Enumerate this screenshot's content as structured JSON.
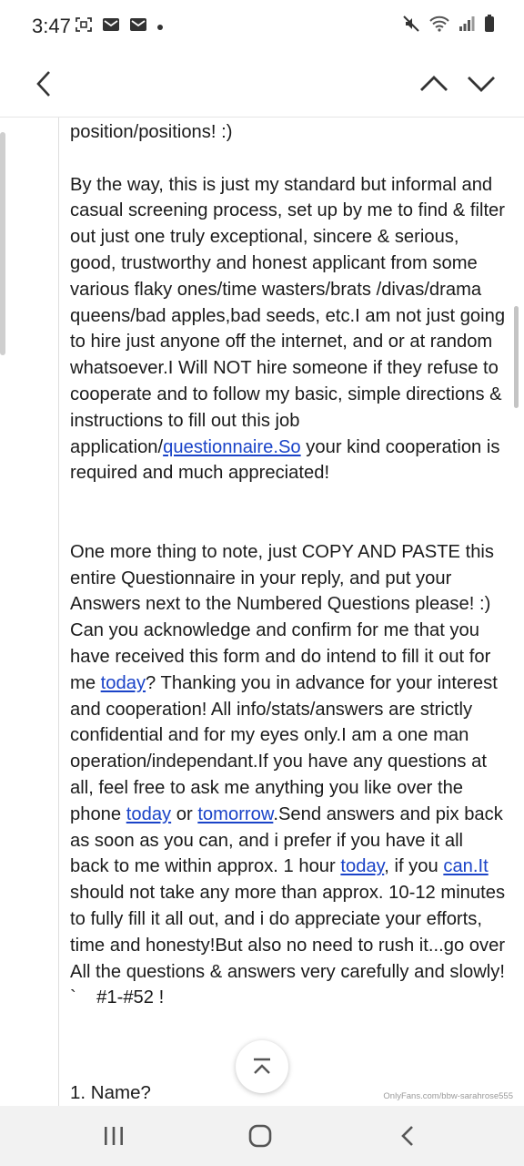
{
  "status_bar": {
    "time": "3:47",
    "left_icons": [
      "screenshot-icon",
      "mail-icon",
      "mail-icon",
      "dot-icon"
    ],
    "right_icons": [
      "mute-icon",
      "wifi-icon",
      "signal-icon",
      "battery-icon"
    ]
  },
  "header": {
    "back_icon": "chevron-left-icon",
    "prev_icon": "chevron-up-icon",
    "next_icon": "chevron-down-icon"
  },
  "email": {
    "p1": "position/positions! :)",
    "p2_a": "By the way, this is just my standard but informal and casual screening process, set up by me to find & filter out just one truly exceptional, sincere & serious, good, trustworthy and honest applicant from some various flaky ones/time wasters/brats /divas/drama queens/bad apples,bad seeds, etc.I am not just going to hire just anyone off the internet, and or at random whatsoever.I Will NOT hire someone if they refuse to cooperate and to follow my basic, simple directions & instructions to fill out this job application/",
    "p2_link": "questionnaire.So",
    "p2_b": " your kind cooperation is required and much appreciated!",
    "p3_a": "One more thing to note, just COPY AND PASTE this entire Questionnaire in your reply, and put your Answers next to the Numbered Questions please! :)  Can you acknowledge and confirm for me that you have received this form and do intend to fill it out for me ",
    "p3_link1": "today",
    "p3_b": "? Thanking you in advance for your interest and cooperation! All info/stats/answers are strictly confidential and for my eyes only.I am a one man operation/independant.If you have any questions at all, feel free to ask me anything you like over the phone ",
    "p3_link2": "today",
    "p3_c": " or ",
    "p3_link3": "tomorrow",
    "p3_d": ".Send answers and pix back as soon as you can, and i prefer if you have it all back to me within approx. 1 hour ",
    "p3_link4": "today",
    "p3_e": ", if you ",
    "p3_link5": "can.It",
    "p3_f": " should not take any more than approx. 10-12 minutes to fully fill it all out, and i do appreciate your efforts, time and honesty!But also no need to rush it...go over All the questions & answers very carefully and slowly! `    #1-#52 !",
    "list_item_1": "1.  Name?"
  },
  "overlay": {
    "scroll_top_icon": "scroll-to-top-icon",
    "watermark": "OnlyFans.com/bbw-sarahrose555"
  },
  "nav_bar": {
    "recents_icon": "recents-icon",
    "home_icon": "home-icon",
    "back_icon": "back-icon"
  },
  "colors": {
    "link": "#1a43c8",
    "text": "#1b1b1b",
    "nav_bar_bg": "#f2f2f2"
  }
}
